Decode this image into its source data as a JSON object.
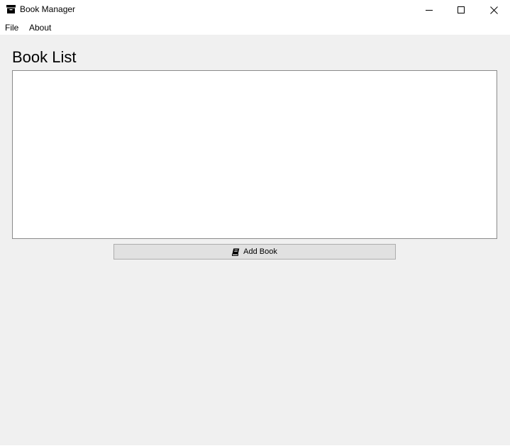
{
  "window": {
    "title": "Book Manager",
    "icons": {
      "app": "archive-box-icon",
      "minimize": "minimize-icon",
      "maximize": "maximize-icon",
      "close": "close-icon"
    }
  },
  "menu": {
    "items": [
      {
        "label": "File"
      },
      {
        "label": "About"
      }
    ]
  },
  "main": {
    "heading": "Book List",
    "book_list": [],
    "add_button": {
      "label": "Add Book",
      "icon": "book-icon"
    }
  },
  "colors": {
    "background": "#f0f0f0",
    "titlebar": "#ffffff",
    "button_face": "#e1e1e1",
    "button_border": "#adadad",
    "list_border": "#8a8a8a"
  }
}
